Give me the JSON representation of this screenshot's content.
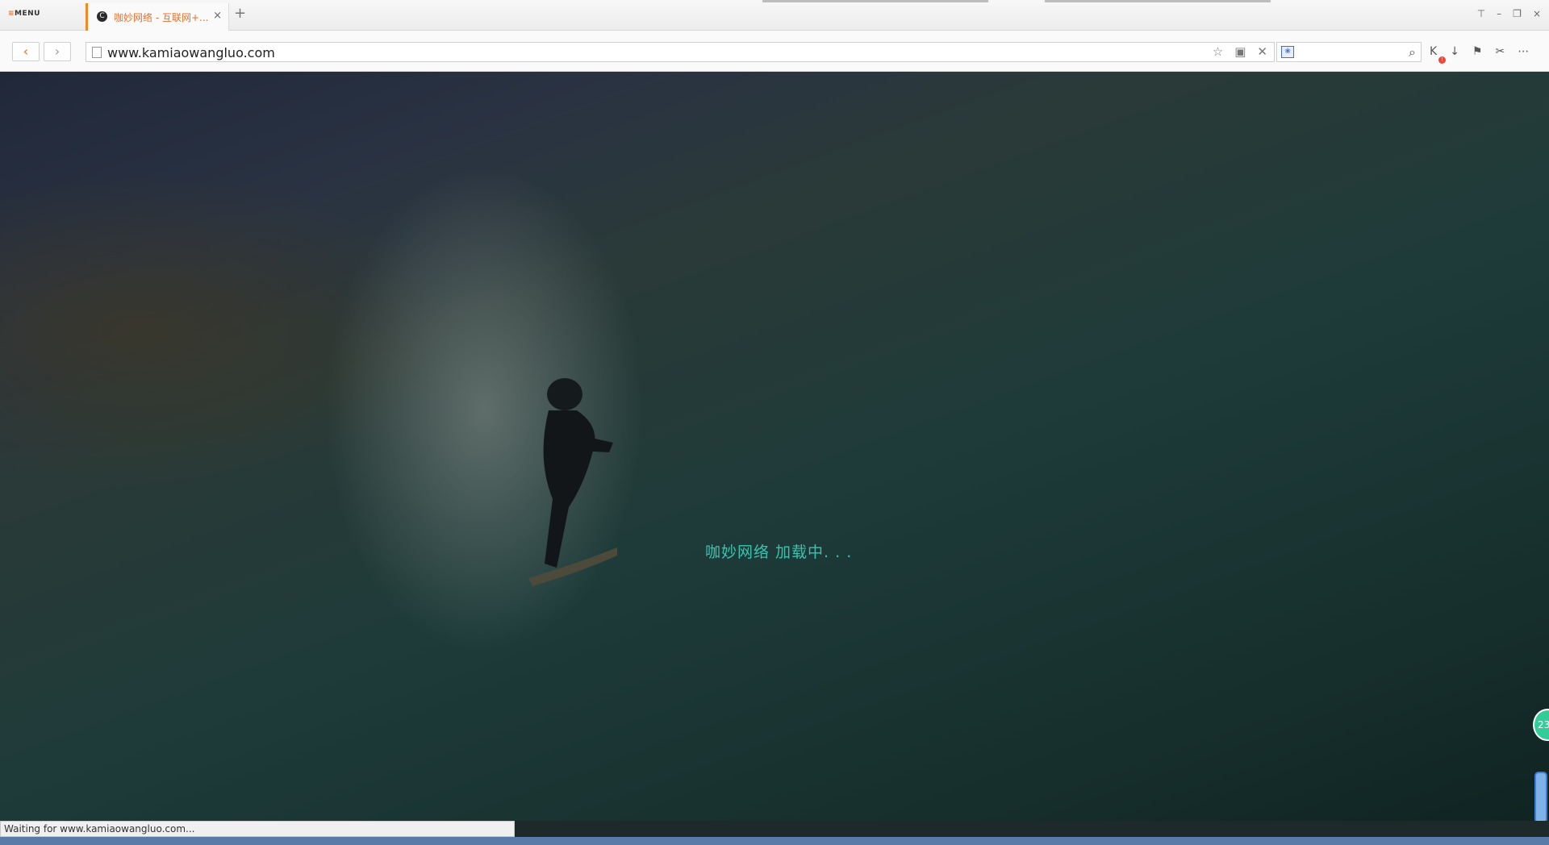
{
  "browser": {
    "menu_label": "MENU",
    "tab": {
      "title": "咖妙网络 - 互联网+...",
      "favicon_glyph": "C",
      "close_glyph": "×"
    },
    "new_tab_glyph": "+",
    "window_controls": [
      "⊤",
      "–",
      "❐",
      "×"
    ]
  },
  "navigation": {
    "back_glyph": "‹",
    "forward_glyph": "›",
    "url": "www.kamiaowangluo.com",
    "address_icons": [
      "☆",
      "▣",
      "✕"
    ],
    "search_placeholder": "",
    "search_glyph": "⌕",
    "tools": [
      "K",
      "↓",
      "⚑",
      "✂",
      "⋯"
    ],
    "badge": "!"
  },
  "page": {
    "loading_text": "咖妙网络 加载中. . .",
    "bubble_label": "23"
  },
  "status_bar": {
    "text": "Waiting for www.kamiaowangluo.com..."
  },
  "colors": {
    "accent": "#e8702a",
    "loading_text": "#38c4b0"
  }
}
